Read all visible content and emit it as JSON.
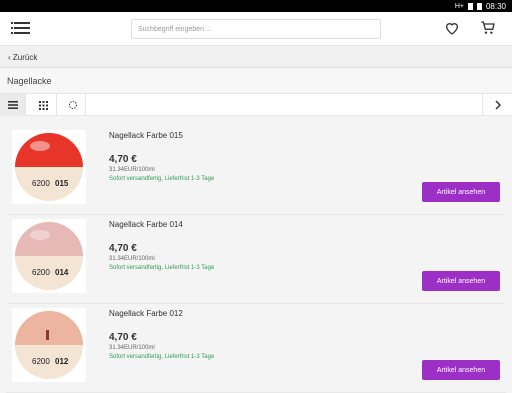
{
  "status": {
    "network": "H+",
    "time": "08:30"
  },
  "header": {
    "search_placeholder": "Suchbegriff eingeben ..."
  },
  "back": {
    "label": "Zurück"
  },
  "page": {
    "title": "Nagellacke"
  },
  "items": [
    {
      "name": "Nagellack Farbe 015",
      "price": "4,70 €",
      "unit_price": "31.34EUR/100ml",
      "shipping": "Sofort versandfertig, Lieferfrist 1-3 Tage",
      "button": "Artikel ansehen",
      "code_prefix": "6200",
      "code": "015",
      "color": "#e8352a"
    },
    {
      "name": "Nagellack Farbe 014",
      "price": "4,70 €",
      "unit_price": "31.34EUR/100ml",
      "shipping": "Sofort versandfertig, Lieferfrist 1-3 Tage",
      "button": "Artikel ansehen",
      "code_prefix": "6200",
      "code": "014",
      "color": "#e6b9b6"
    },
    {
      "name": "Nagellack Farbe 012",
      "price": "4,70 €",
      "unit_price": "31.34EUR/100ml",
      "shipping": "Sofort versandfertig, Lieferfrist 1-3 Tage",
      "button": "Artikel ansehen",
      "code_prefix": "6200",
      "code": "012",
      "color": "#ecb59f"
    }
  ]
}
